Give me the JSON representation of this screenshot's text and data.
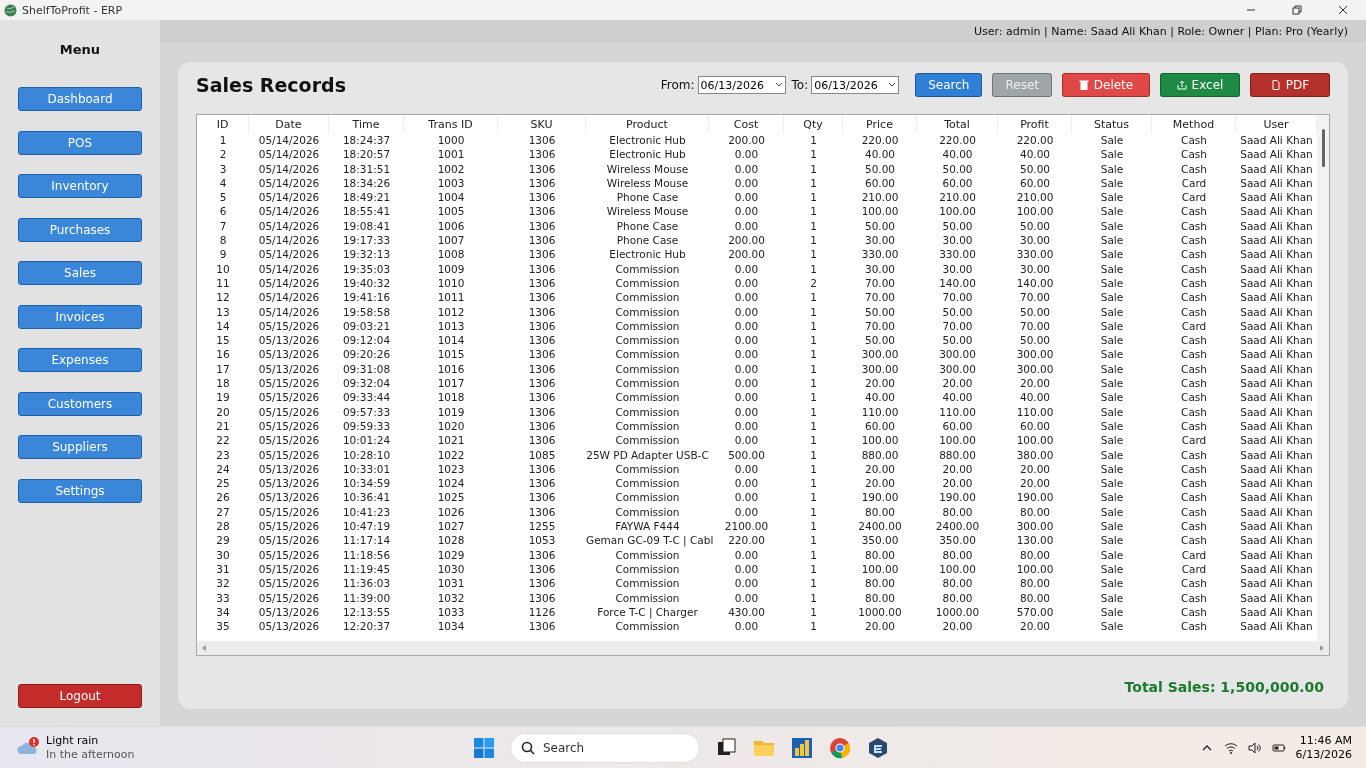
{
  "window": {
    "title": "ShelfToProfit - ERP"
  },
  "user_bar": "User: admin | Name: Saad Ali Khan | Role: Owner | Plan: Pro (Yearly)",
  "sidebar": {
    "heading": "Menu",
    "items": [
      "Dashboard",
      "POS",
      "Inventory",
      "Purchases",
      "Sales",
      "Invoices",
      "Expenses",
      "Customers",
      "Suppliers",
      "Settings"
    ],
    "logout": "Logout"
  },
  "page": {
    "title": "Sales Records",
    "from_label": "From:",
    "from_value": "06/13/2026",
    "to_label": "To:",
    "to_value": "06/13/2026",
    "buttons": [
      {
        "label": "Search",
        "kind": "primary"
      },
      {
        "label": "Reset",
        "kind": "neutral"
      },
      {
        "label": "Delete",
        "kind": "danger"
      },
      {
        "label": "Excel",
        "kind": "success"
      },
      {
        "label": "PDF",
        "kind": "dark"
      }
    ]
  },
  "table": {
    "columns": [
      "ID",
      "Date",
      "Time",
      "Trans ID",
      "SKU",
      "Product",
      "Cost",
      "Qty",
      "Price",
      "Total",
      "Profit",
      "Status",
      "Method",
      "User"
    ],
    "rows": [
      [
        "1",
        "05/14/2026",
        "18:24:37",
        "1000",
        "1306",
        "Electronic Hub",
        "200.00",
        "1",
        "220.00",
        "220.00",
        "220.00",
        "Sale",
        "Cash",
        "Saad Ali Khan"
      ],
      [
        "2",
        "05/14/2026",
        "18:20:57",
        "1001",
        "1306",
        "Electronic Hub",
        "0.00",
        "1",
        "40.00",
        "40.00",
        "40.00",
        "Sale",
        "Cash",
        "Saad Ali Khan"
      ],
      [
        "3",
        "05/14/2026",
        "18:31:51",
        "1002",
        "1306",
        "Wireless Mouse",
        "0.00",
        "1",
        "50.00",
        "50.00",
        "50.00",
        "Sale",
        "Cash",
        "Saad Ali Khan"
      ],
      [
        "4",
        "05/14/2026",
        "18:34:26",
        "1003",
        "1306",
        "Wireless Mouse",
        "0.00",
        "1",
        "60.00",
        "60.00",
        "60.00",
        "Sale",
        "Card",
        "Saad Ali Khan"
      ],
      [
        "5",
        "05/14/2026",
        "18:49:21",
        "1004",
        "1306",
        "Phone Case",
        "0.00",
        "1",
        "210.00",
        "210.00",
        "210.00",
        "Sale",
        "Card",
        "Saad Ali Khan"
      ],
      [
        "6",
        "05/14/2026",
        "18:55:41",
        "1005",
        "1306",
        "Wireless Mouse",
        "0.00",
        "1",
        "100.00",
        "100.00",
        "100.00",
        "Sale",
        "Cash",
        "Saad Ali Khan"
      ],
      [
        "7",
        "05/14/2026",
        "19:08:41",
        "1006",
        "1306",
        "Phone Case",
        "0.00",
        "1",
        "50.00",
        "50.00",
        "50.00",
        "Sale",
        "Cash",
        "Saad Ali Khan"
      ],
      [
        "8",
        "05/14/2026",
        "19:17:33",
        "1007",
        "1306",
        "Phone Case",
        "200.00",
        "1",
        "30.00",
        "30.00",
        "30.00",
        "Sale",
        "Cash",
        "Saad Ali Khan"
      ],
      [
        "9",
        "05/14/2026",
        "19:32:13",
        "1008",
        "1306",
        "Electronic Hub",
        "200.00",
        "1",
        "330.00",
        "330.00",
        "330.00",
        "Sale",
        "Cash",
        "Saad Ali Khan"
      ],
      [
        "10",
        "05/14/2026",
        "19:35:03",
        "1009",
        "1306",
        "Commission",
        "0.00",
        "1",
        "30.00",
        "30.00",
        "30.00",
        "Sale",
        "Cash",
        "Saad Ali Khan"
      ],
      [
        "11",
        "05/14/2026",
        "19:40:32",
        "1010",
        "1306",
        "Commission",
        "0.00",
        "2",
        "70.00",
        "140.00",
        "140.00",
        "Sale",
        "Cash",
        "Saad Ali Khan"
      ],
      [
        "12",
        "05/14/2026",
        "19:41:16",
        "1011",
        "1306",
        "Commission",
        "0.00",
        "1",
        "70.00",
        "70.00",
        "70.00",
        "Sale",
        "Cash",
        "Saad Ali Khan"
      ],
      [
        "13",
        "05/14/2026",
        "19:58:58",
        "1012",
        "1306",
        "Commission",
        "0.00",
        "1",
        "50.00",
        "50.00",
        "50.00",
        "Sale",
        "Cash",
        "Saad Ali Khan"
      ],
      [
        "14",
        "05/15/2026",
        "09:03:21",
        "1013",
        "1306",
        "Commission",
        "0.00",
        "1",
        "70.00",
        "70.00",
        "70.00",
        "Sale",
        "Card",
        "Saad Ali Khan"
      ],
      [
        "15",
        "05/13/2026",
        "09:12:04",
        "1014",
        "1306",
        "Commission",
        "0.00",
        "1",
        "50.00",
        "50.00",
        "50.00",
        "Sale",
        "Cash",
        "Saad Ali Khan"
      ],
      [
        "16",
        "05/13/2026",
        "09:20:26",
        "1015",
        "1306",
        "Commission",
        "0.00",
        "1",
        "300.00",
        "300.00",
        "300.00",
        "Sale",
        "Cash",
        "Saad Ali Khan"
      ],
      [
        "17",
        "05/13/2026",
        "09:31:08",
        "1016",
        "1306",
        "Commission",
        "0.00",
        "1",
        "300.00",
        "300.00",
        "300.00",
        "Sale",
        "Cash",
        "Saad Ali Khan"
      ],
      [
        "18",
        "05/15/2026",
        "09:32:04",
        "1017",
        "1306",
        "Commission",
        "0.00",
        "1",
        "20.00",
        "20.00",
        "20.00",
        "Sale",
        "Cash",
        "Saad Ali Khan"
      ],
      [
        "19",
        "05/15/2026",
        "09:33:44",
        "1018",
        "1306",
        "Commission",
        "0.00",
        "1",
        "40.00",
        "40.00",
        "40.00",
        "Sale",
        "Cash",
        "Saad Ali Khan"
      ],
      [
        "20",
        "05/15/2026",
        "09:57:33",
        "1019",
        "1306",
        "Commission",
        "0.00",
        "1",
        "110.00",
        "110.00",
        "110.00",
        "Sale",
        "Cash",
        "Saad Ali Khan"
      ],
      [
        "21",
        "05/15/2026",
        "09:59:33",
        "1020",
        "1306",
        "Commission",
        "0.00",
        "1",
        "60.00",
        "60.00",
        "60.00",
        "Sale",
        "Cash",
        "Saad Ali Khan"
      ],
      [
        "22",
        "05/15/2026",
        "10:01:24",
        "1021",
        "1306",
        "Commission",
        "0.00",
        "1",
        "100.00",
        "100.00",
        "100.00",
        "Sale",
        "Card",
        "Saad Ali Khan"
      ],
      [
        "23",
        "05/15/2026",
        "10:28:10",
        "1022",
        "1085",
        "25W PD Adapter USB-C",
        "500.00",
        "1",
        "880.00",
        "880.00",
        "380.00",
        "Sale",
        "Cash",
        "Saad Ali Khan"
      ],
      [
        "24",
        "05/13/2026",
        "10:33:01",
        "1023",
        "1306",
        "Commission",
        "0.00",
        "1",
        "20.00",
        "20.00",
        "20.00",
        "Sale",
        "Cash",
        "Saad Ali Khan"
      ],
      [
        "25",
        "05/13/2026",
        "10:34:59",
        "1024",
        "1306",
        "Commission",
        "0.00",
        "1",
        "20.00",
        "20.00",
        "20.00",
        "Sale",
        "Cash",
        "Saad Ali Khan"
      ],
      [
        "26",
        "05/13/2026",
        "10:36:41",
        "1025",
        "1306",
        "Commission",
        "0.00",
        "1",
        "190.00",
        "190.00",
        "190.00",
        "Sale",
        "Cash",
        "Saad Ali Khan"
      ],
      [
        "27",
        "05/15/2026",
        "10:41:23",
        "1026",
        "1306",
        "Commission",
        "0.00",
        "1",
        "80.00",
        "80.00",
        "80.00",
        "Sale",
        "Cash",
        "Saad Ali Khan"
      ],
      [
        "28",
        "05/15/2026",
        "10:47:19",
        "1027",
        "1255",
        "FAYWA F444",
        "2100.00",
        "1",
        "2400.00",
        "2400.00",
        "300.00",
        "Sale",
        "Cash",
        "Saad Ali Khan"
      ],
      [
        "29",
        "05/15/2026",
        "11:17:14",
        "1028",
        "1053",
        "Geman GC-09 T-C | Cabl",
        "220.00",
        "1",
        "350.00",
        "350.00",
        "130.00",
        "Sale",
        "Cash",
        "Saad Ali Khan"
      ],
      [
        "30",
        "05/15/2026",
        "11:18:56",
        "1029",
        "1306",
        "Commission",
        "0.00",
        "1",
        "80.00",
        "80.00",
        "80.00",
        "Sale",
        "Card",
        "Saad Ali Khan"
      ],
      [
        "31",
        "05/15/2026",
        "11:19:45",
        "1030",
        "1306",
        "Commission",
        "0.00",
        "1",
        "100.00",
        "100.00",
        "100.00",
        "Sale",
        "Card",
        "Saad Ali Khan"
      ],
      [
        "32",
        "05/15/2026",
        "11:36:03",
        "1031",
        "1306",
        "Commission",
        "0.00",
        "1",
        "80.00",
        "80.00",
        "80.00",
        "Sale",
        "Cash",
        "Saad Ali Khan"
      ],
      [
        "33",
        "05/15/2026",
        "11:39:00",
        "1032",
        "1306",
        "Commission",
        "0.00",
        "1",
        "80.00",
        "80.00",
        "80.00",
        "Sale",
        "Cash",
        "Saad Ali Khan"
      ],
      [
        "34",
        "05/13/2026",
        "12:13:55",
        "1033",
        "1126",
        "Force T-C | Charger",
        "430.00",
        "1",
        "1000.00",
        "1000.00",
        "570.00",
        "Sale",
        "Cash",
        "Saad Ali Khan"
      ],
      [
        "35",
        "05/13/2026",
        "12:20:37",
        "1034",
        "1306",
        "Commission",
        "0.00",
        "1",
        "20.00",
        "20.00",
        "20.00",
        "Sale",
        "Cash",
        "Saad Ali Khan"
      ]
    ]
  },
  "total_sales": "Total Sales: 1,500,000.00",
  "taskbar": {
    "weather_title": "Light rain",
    "weather_subtitle": "In the afternoon",
    "search_placeholder": "Search",
    "time": "11:46 AM",
    "date": "6/13/2026"
  }
}
